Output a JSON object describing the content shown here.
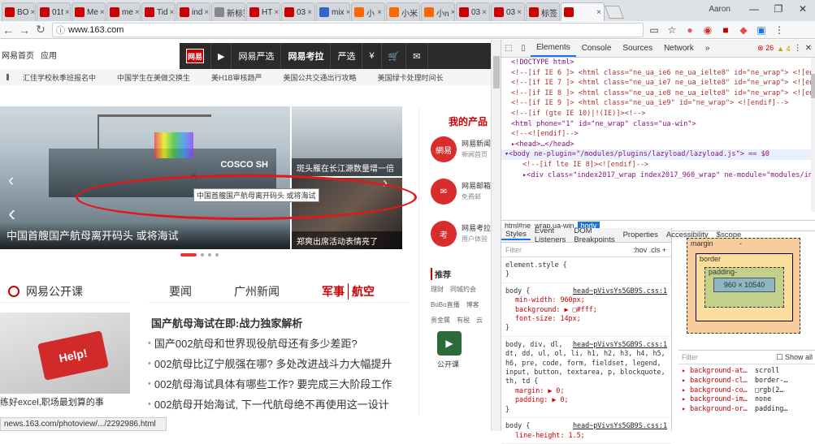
{
  "tabs": [
    {
      "label": "BO",
      "color": "#c00"
    },
    {
      "label": "01t",
      "color": "#c00"
    },
    {
      "label": "Me",
      "color": "#c00"
    },
    {
      "label": "me",
      "color": "#c00"
    },
    {
      "label": "Tid",
      "color": "#c00"
    },
    {
      "label": "ind",
      "color": "#c00"
    },
    {
      "label": "新标签",
      "color": "#888"
    },
    {
      "label": "HT",
      "color": "#c00"
    },
    {
      "label": "03",
      "color": "#c00"
    },
    {
      "label": "mix",
      "color": "#36c"
    },
    {
      "label": "小",
      "color": "#f60"
    },
    {
      "label": "小米",
      "color": "#f60"
    },
    {
      "label": "小n",
      "color": "#f60"
    },
    {
      "label": "03",
      "color": "#c00"
    },
    {
      "label": "03",
      "color": "#c00"
    },
    {
      "label": "标签",
      "color": "#c00"
    },
    {
      "label": "",
      "color": "#c00",
      "active": true
    }
  ],
  "window": {
    "user": "Aaron",
    "minimize": "—",
    "maximize": "❐",
    "close": "✕"
  },
  "address": {
    "url": "www.163.com"
  },
  "site": {
    "top_links": [
      "网易首页",
      "应用"
    ],
    "nav": [
      "网易",
      "",
      "网易严选",
      "网易考拉",
      "严选",
      "¥",
      "",
      "✉"
    ],
    "ticker": [
      "汇佳学校秋季班报名中",
      "中国学生在美做交换生",
      "美H1B审核趋严",
      "美国公共交通出行攻略",
      "美国绿卡处理时间长"
    ],
    "carousel_caption": "中国首艘国产航母离开码头 或将海试",
    "tooltip": "中国首艘国产航母离开码头 或将海试",
    "side1_caption": "斑头雁在长江源数量增一倍",
    "side2_caption": "郑爽出席活动表情亮了",
    "myprod_title": "我的产品",
    "products": [
      {
        "icon": "網易",
        "name": "网易新闻",
        "sub": "新闻首页"
      },
      {
        "icon": "✉",
        "name": "网易邮箱",
        "sub": "免费邮"
      },
      {
        "icon": "考",
        "name": "网易考拉",
        "sub": "用户体验"
      }
    ],
    "recommend": {
      "title": "推荐",
      "row1": [
        "理财",
        "同城约会"
      ],
      "row2": [
        "BoBo直播",
        "博客"
      ],
      "row3": [
        "贵金属",
        "有税",
        "云"
      ],
      "app": "公开课"
    },
    "opencourse": "网易公开课",
    "news_tabs": [
      "要闻",
      "广州新闻",
      "军事",
      "航空"
    ],
    "news": [
      "国产航母海试在即:战力独家解析",
      "国产002航母和世界现役航母还有多少差距?",
      "002航母比辽宁舰强在哪? 多处改进战斗力大幅提升",
      "002航母海试具体有哪些工作? 要完成三大阶段工作",
      "002航母开始海试, 下一代航母绝不再使用这一设计"
    ],
    "help_caption": "练好excel,职场最划算的事",
    "help_key": "Help!",
    "ad": "广告",
    "status": "news.163.com/photoview/.../2292986.html"
  },
  "devtools": {
    "tabs": [
      "Elements",
      "Console",
      "Sources",
      "Network"
    ],
    "errors": "26",
    "warnings": "4",
    "dom": [
      "<!DOCTYPE html>",
      "<!--[if IE 6 ]> <html class=\"ne_ua_ie6 ne_ua_ielte8\" id=\"ne_wrap\"> <![endif]-->",
      "<!--[if IE 7 ]> <html class=\"ne_ua_ie7 ne_ua_ielte8\" id=\"ne_wrap\"> <![endif]-->",
      "<!--[if IE 8 ]> <html class=\"ne_ua_ie8 ne_ua_ielte8\" id=\"ne_wrap\"> <![endif]-->",
      "<!--[if IE 9 ]> <html class=\"ne_ua_ie9\" id=\"ne_wrap\"> <![endif]-->",
      "<!--[if (gte IE 10)|!(IE)]><!-->",
      "<html phone=\"1\" id=\"ne_wrap\" class=\"ua-win\">",
      "<!--<![endif]-->",
      "▸<head>…</head>",
      "▾<body ne-plugin=\"/modules/plugins/lazyload/lazyload.js\"> == $0",
      "<!--[if lte IE 8]><![endif]-->",
      "▸<div class=\"index2017_wrap index2017_960_wrap\" ne-module=\"modules/index2017.js\" id=\"js_index2017_wrap\" ne-plugin=\"js/plugins/"
    ],
    "crumbs": [
      "html#ne_wrap.ua-win",
      "body"
    ],
    "style_tabs": [
      "Styles",
      "Event Listeners",
      "DOM Breakpoints",
      "Properties",
      "Accessibility",
      "$scope"
    ],
    "filter": "Filter",
    "filter_right": ":hov  .cls  +",
    "rules": [
      {
        "sel": "element.style {",
        "link": "",
        "props": [
          "}"
        ]
      },
      {
        "sel": "body {",
        "link": "head~pVivsYs5GB9S.css:1",
        "props": [
          "min-width: 960px;",
          "background: ▶ □#fff;",
          "font-size: 14px;",
          "}"
        ]
      },
      {
        "sel": "body, div, dl, dt, dd, ul, ol, li, h1, h2, h3, h4, h5, h6, pre, code, form, fieldset, legend, input, button, textarea, p, blockquote, th, td {",
        "link": "head~pVivsYs5GB9S.css:1",
        "props": [
          "margin: ▶ 0;",
          "padding: ▶ 0;",
          "}"
        ]
      },
      {
        "sel": "body {",
        "link": "head~pVivsYs5GB9S.css:1",
        "props": [
          "line-height: 1.5;"
        ]
      }
    ],
    "box": {
      "margin": "margin",
      "border": "border",
      "padding": "padding-",
      "content": "960 × 10540",
      "dash": "-"
    },
    "computed_filter": "Filter",
    "show_all": "Show all",
    "computed": [
      {
        "p": "background-at…",
        "v": "scroll"
      },
      {
        "p": "background-cl…",
        "v": "border-…"
      },
      {
        "p": "background-co…",
        "v": "□rgb(2…"
      },
      {
        "p": "background-im…",
        "v": "none"
      },
      {
        "p": "background-or…",
        "v": "padding…"
      }
    ],
    "watermark": "blog.csdn.net/..."
  }
}
